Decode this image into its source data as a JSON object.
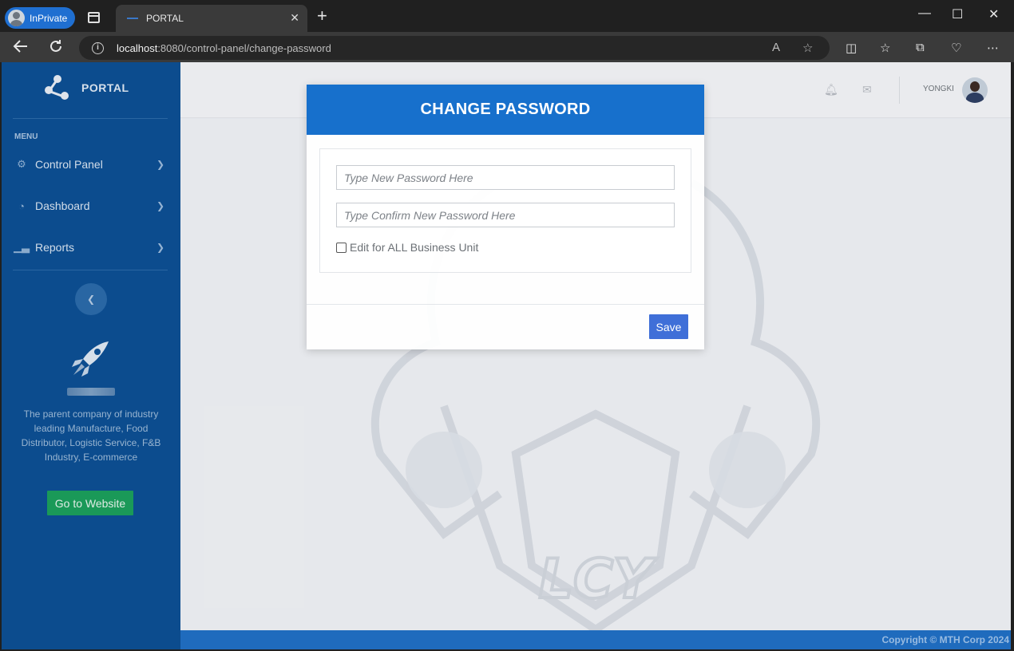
{
  "browser": {
    "profile_label": "InPrivate",
    "tab_title": "PORTAL",
    "tab_close": "✕",
    "new_tab": "+",
    "url_host": "localhost",
    "url_path": ":8080/control-panel/change-password",
    "window_minimize": "—",
    "window_maximize": "☐",
    "window_close": "✕"
  },
  "sidebar": {
    "brand": "PORTAL",
    "menu_label": "MENU",
    "items": [
      {
        "label": "Control Panel",
        "icon": "gear-icon"
      },
      {
        "label": "Dashboard",
        "icon": "gauge-icon"
      },
      {
        "label": "Reports",
        "icon": "chart-icon"
      }
    ],
    "description": "The parent company of industry leading Manufacture, Food Distributor, Logistic Service, F&B Industry, E-commerce",
    "cta": "Go to Website"
  },
  "topbar": {
    "user_name": "YONGKI"
  },
  "modal": {
    "title": "CHANGE PASSWORD",
    "new_password_placeholder": "Type New Password Here",
    "confirm_password_placeholder": "Type Confirm New Password Here",
    "checkbox_label": "Edit for ALL Business Unit",
    "save_label": "Save"
  },
  "footer": {
    "copyright": "Copyright © MTH Corp 2024"
  },
  "colors": {
    "sidebar_bg": "#0b4f93",
    "modal_header": "#1770cc",
    "save_button": "#3f6fd8",
    "cta_button": "#1aa05a",
    "footer_bg": "#1f6fc4"
  }
}
